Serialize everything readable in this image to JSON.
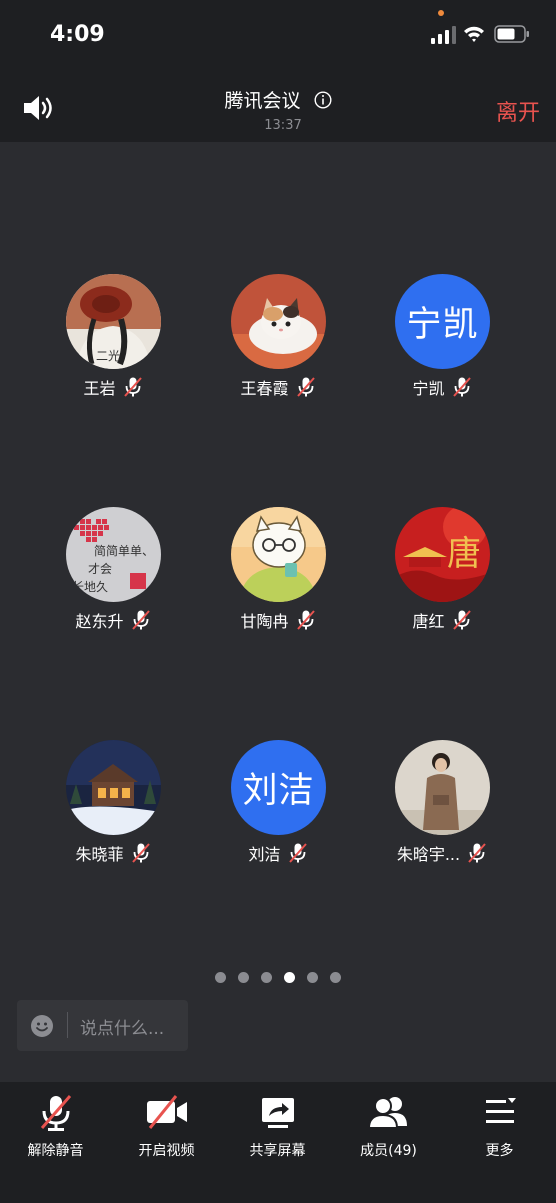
{
  "status": {
    "time": "4:09"
  },
  "header": {
    "title": "腾讯会议",
    "timer": "13:37",
    "leave_label": "离开"
  },
  "participants": [
    {
      "name": "王岩",
      "avatar_type": "photo",
      "muted": true
    },
    {
      "name": "王春霞",
      "avatar_type": "photo",
      "muted": true
    },
    {
      "name": "宁凯",
      "avatar_type": "text",
      "avatar_text": "宁凯",
      "muted": true
    },
    {
      "name": "赵东升",
      "avatar_type": "photo",
      "avatar_text_lines": [
        "简简单单、",
        "才会",
        "长地久"
      ],
      "muted": true
    },
    {
      "name": "甘陶冉",
      "avatar_type": "photo",
      "muted": true
    },
    {
      "name": "唐红",
      "avatar_type": "photo",
      "avatar_text": "唐",
      "muted": true
    },
    {
      "name": "朱晓菲",
      "avatar_type": "photo",
      "muted": true
    },
    {
      "name": "刘洁",
      "avatar_type": "text",
      "avatar_text": "刘洁",
      "muted": true
    },
    {
      "name": "朱晗宇...",
      "avatar_type": "photo",
      "muted": true
    }
  ],
  "pager": {
    "total": 6,
    "active_index": 3
  },
  "chat": {
    "placeholder": "说点什么..."
  },
  "toolbar": {
    "unmute_label": "解除静音",
    "video_label": "开启视频",
    "share_label": "共享屏幕",
    "members_label": "成员(49)",
    "more_label": "更多"
  },
  "colors": {
    "accent_blue": "#2f6ff0",
    "leave_red": "#e8534f",
    "background": "#2b2c30",
    "bar": "#1e1f22"
  }
}
